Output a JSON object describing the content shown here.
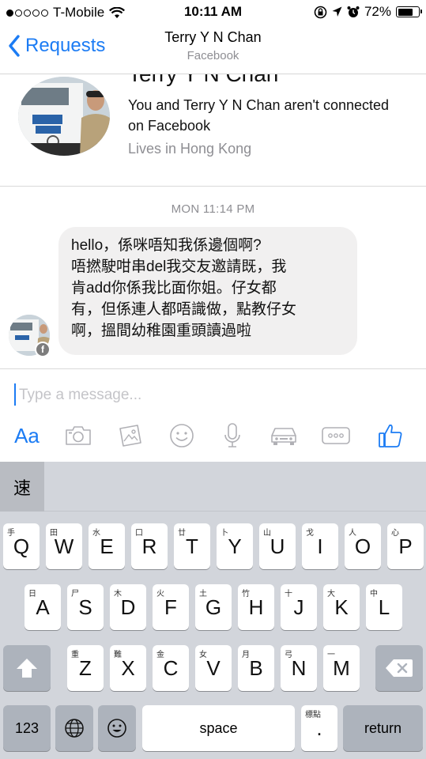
{
  "status": {
    "carrier": "T-Mobile",
    "time": "10:11 AM",
    "battery": "72%",
    "battery_level": 0.72,
    "signal_bars": 1
  },
  "nav": {
    "back_label": "Requests",
    "title": "Terry Y N Chan",
    "subtitle": "Facebook"
  },
  "profile": {
    "name_partial": "Terry Y N Chan",
    "connection_text": "You and Terry Y N Chan aren't connected on Facebook",
    "location": "Lives in Hong Kong"
  },
  "chat": {
    "timestamp": "MON 11:14 PM",
    "message_lines": [
      "hello，係咪唔知我係邊個啊?",
      "唔撚駛咁串del我交友邀請既，我",
      "肯add你係我比面你姐。仔女都",
      "有，但係連人都唔識做，點教仔女",
      "啊，搵間幼稚園重頭讀過啦"
    ]
  },
  "composer": {
    "placeholder": "Type a message...",
    "aa_label": "Aa"
  },
  "keyboard": {
    "suggestion": "速",
    "row1": [
      {
        "sub": "手",
        "key": "Q"
      },
      {
        "sub": "田",
        "key": "W"
      },
      {
        "sub": "水",
        "key": "E"
      },
      {
        "sub": "口",
        "key": "R"
      },
      {
        "sub": "廿",
        "key": "T"
      },
      {
        "sub": "卜",
        "key": "Y"
      },
      {
        "sub": "山",
        "key": "U"
      },
      {
        "sub": "戈",
        "key": "I"
      },
      {
        "sub": "人",
        "key": "O"
      },
      {
        "sub": "心",
        "key": "P"
      }
    ],
    "row2": [
      {
        "sub": "日",
        "key": "A"
      },
      {
        "sub": "尸",
        "key": "S"
      },
      {
        "sub": "木",
        "key": "D"
      },
      {
        "sub": "火",
        "key": "F"
      },
      {
        "sub": "土",
        "key": "G"
      },
      {
        "sub": "竹",
        "key": "H"
      },
      {
        "sub": "十",
        "key": "J"
      },
      {
        "sub": "大",
        "key": "K"
      },
      {
        "sub": "中",
        "key": "L"
      }
    ],
    "row3": [
      {
        "sub": "重",
        "key": "Z"
      },
      {
        "sub": "難",
        "key": "X"
      },
      {
        "sub": "金",
        "key": "C"
      },
      {
        "sub": "女",
        "key": "V"
      },
      {
        "sub": "月",
        "key": "B"
      },
      {
        "sub": "弓",
        "key": "N"
      },
      {
        "sub": "一",
        "key": "M"
      }
    ],
    "numbers_label": "123",
    "space_label": "space",
    "punct_sub": "標點",
    "punct_key": ".",
    "return_label": "return"
  },
  "colors": {
    "accent": "#1c7cf4",
    "bubble": "#f1f0f0",
    "keyboard_bg": "#d2d5db"
  }
}
